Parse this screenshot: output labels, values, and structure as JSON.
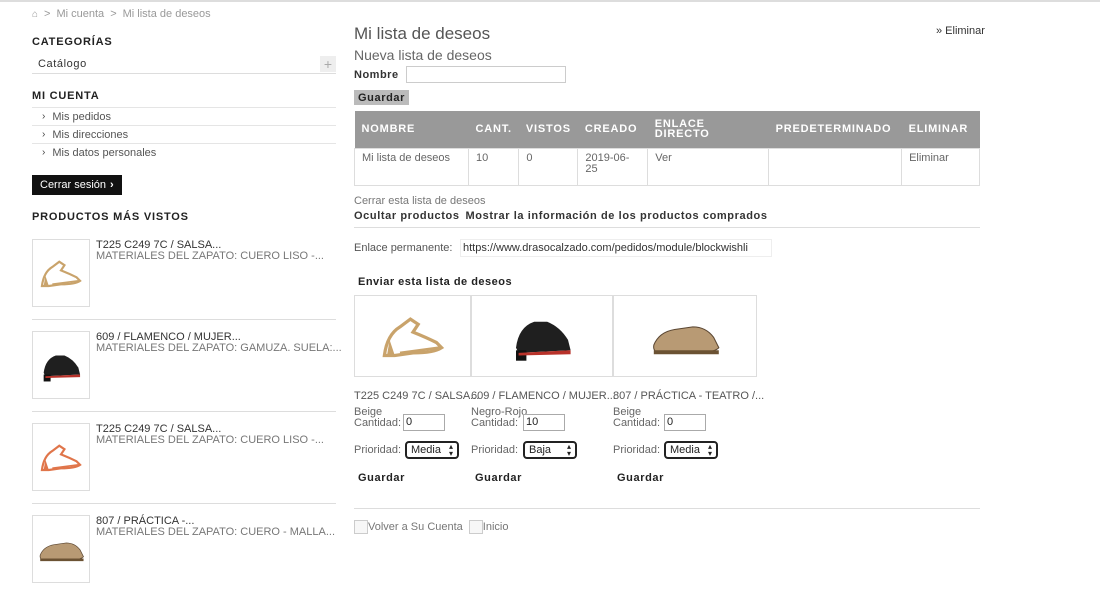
{
  "breadcrumb": {
    "home": "⌂",
    "sep1": ">",
    "account": "Mi cuenta",
    "sep2": ">",
    "current": "Mi lista de deseos"
  },
  "sidebar": {
    "categories_title": "CATEGORÍAS",
    "catalog_label": "Catálogo",
    "plus": "+",
    "account_title": "MI CUENTA",
    "account_items": [
      "Mis pedidos",
      "Mis direcciones",
      "Mis datos personales"
    ],
    "logout_label": "Cerrar sesión",
    "logout_icon": "chevron-right",
    "viewed_title": "PRODUCTOS MÁS VISTOS",
    "viewed": [
      {
        "title": "T225 C249 7C / SALSA...",
        "desc": "MATERIALES DEL ZAPATO: CUERO LISO -...",
        "color": "#c9a36b"
      },
      {
        "title": "609 / FLAMENCO / MUJER...",
        "desc": "MATERIALES DEL ZAPATO: GAMUZA. SUELA:...",
        "color": "#1f1f1f"
      },
      {
        "title": "T225 C249 7C / SALSA...",
        "desc": "MATERIALES DEL ZAPATO: CUERO LISO -...",
        "color": "#e0754a"
      },
      {
        "title": "807 / PRÁCTICA -...",
        "desc": "MATERIALES DEL ZAPATO: CUERO - MALLA...",
        "color": "#b89a74"
      }
    ]
  },
  "main": {
    "title": "Mi lista de deseos",
    "delete_link": "» Eliminar",
    "subtitle": "Nueva lista de deseos",
    "name_label": "Nombre",
    "name_value": "",
    "save_label": "Guardar",
    "table": {
      "headers": [
        "NOMBRE",
        "CANT.",
        "VISTOS",
        "CREADO",
        "ENLACE DIRECTO",
        "PREDETERMINADO",
        "ELIMINAR"
      ],
      "row": [
        "Mi lista de deseos",
        "10",
        "0",
        "2019-06-25",
        "Ver",
        "",
        "Eliminar"
      ]
    },
    "close_list": "Cerrar esta lista de deseos",
    "hide_products": "Ocultar productos",
    "show_bought": "Mostrar la información de los productos comprados",
    "permalink_label": "Enlace permanente:",
    "permalink_value": "https://www.drasocalzado.com/pedidos/module/blockwishli",
    "send_list": "Enviar esta lista de deseos",
    "products": [
      {
        "name": "T225 C249 7C / SALSA...",
        "color_name": "Beige",
        "qty_label": "Cantidad:",
        "qty": "0",
        "prio_label": "Prioridad:",
        "priority": "Media",
        "save": "Guardar",
        "shoe_color": "#c9a36b"
      },
      {
        "name": "609 / FLAMENCO / MUJER...",
        "color_name": "Negro-Rojo",
        "qty_label": "Cantidad:",
        "qty": "10",
        "prio_label": "Prioridad:",
        "priority": "Baja",
        "save": "Guardar",
        "shoe_color": "#1f1f1f"
      },
      {
        "name": "807 / PRÁCTICA - TEATRO /...",
        "color_name": "Beige",
        "qty_label": "Cantidad:",
        "qty": "0",
        "prio_label": "Prioridad:",
        "priority": "Media",
        "save": "Guardar",
        "shoe_color": "#b89a74"
      }
    ],
    "back_account": "Volver a Su Cuenta",
    "home": "Inicio"
  }
}
